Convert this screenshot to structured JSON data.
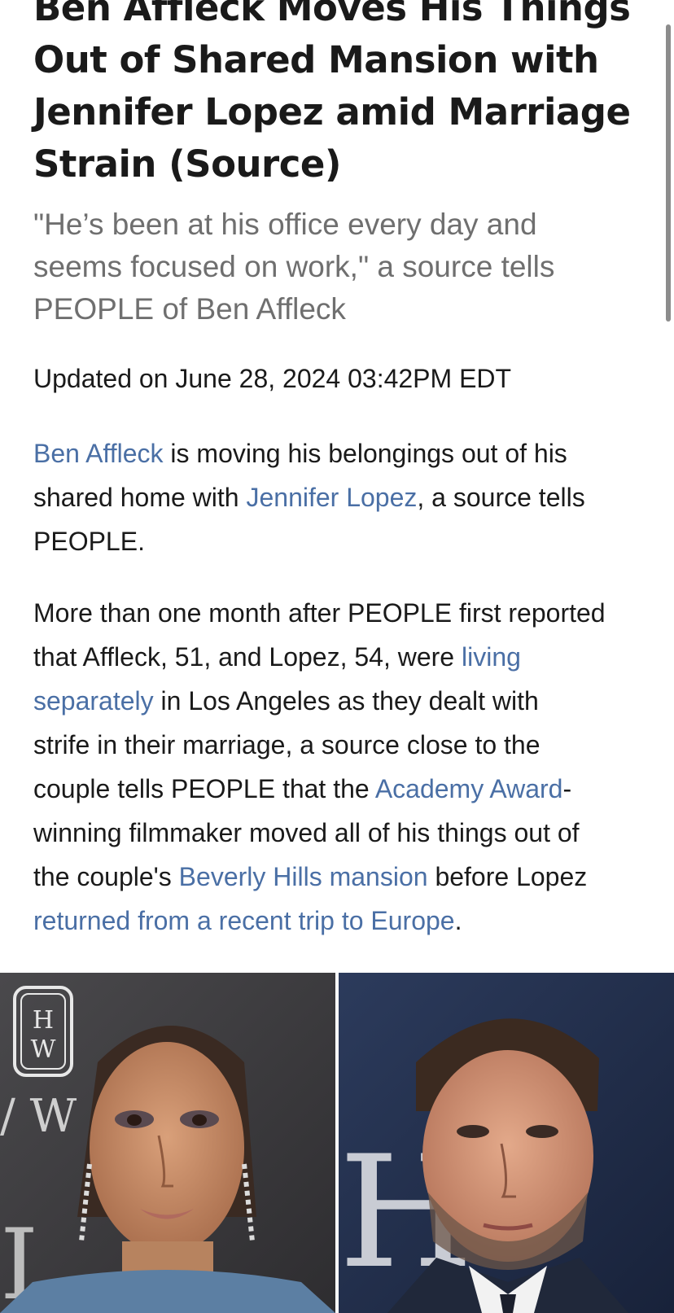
{
  "article": {
    "headline_lines": [
      "Ben Affleck Moves His Things",
      "Out of Shared Mansion with",
      "Jennifer Lopez amid Marriage",
      "Strain (Source)"
    ],
    "subhead_lines": [
      "\"He’s been at his office every day and",
      "seems focused on work,\" a source tells",
      "PEOPLE of Ben Affleck"
    ],
    "updated": "Updated on June 28, 2024 03:42PM EDT",
    "paragraph1": {
      "link_ben": "Ben Affleck",
      "text1": " is moving his belongings out of his",
      "text2": "shared home with ",
      "link_jlo": "Jennifer Lopez",
      "text3": ", a source tells",
      "text4": "PEOPLE."
    },
    "paragraph2": {
      "l1": "More than one month after PEOPLE first reported",
      "l2a": "that Affleck, 51, and Lopez, 54, were ",
      "link_living": "living",
      "link_separately": "separately",
      "l3b": " in Los Angeles as they dealt with",
      "l4": "strife in their marriage, a source close to the",
      "l5a": "couple tells PEOPLE that the ",
      "link_academy": "Academy Award",
      "l5b": "-",
      "l6": "winning filmmaker moved all of his things out of",
      "l7a": "the couple's ",
      "link_beverly": "Beverly Hills mansion",
      "l7b": " before Lopez",
      "link_returned": "returned from a recent trip to Europe",
      "l8b": "."
    },
    "photo": {
      "logo_letters": "H W"
    }
  },
  "colors": {
    "link": "#4a6fa5",
    "subhead": "#6f6f6f",
    "text": "#1a1a1a"
  }
}
